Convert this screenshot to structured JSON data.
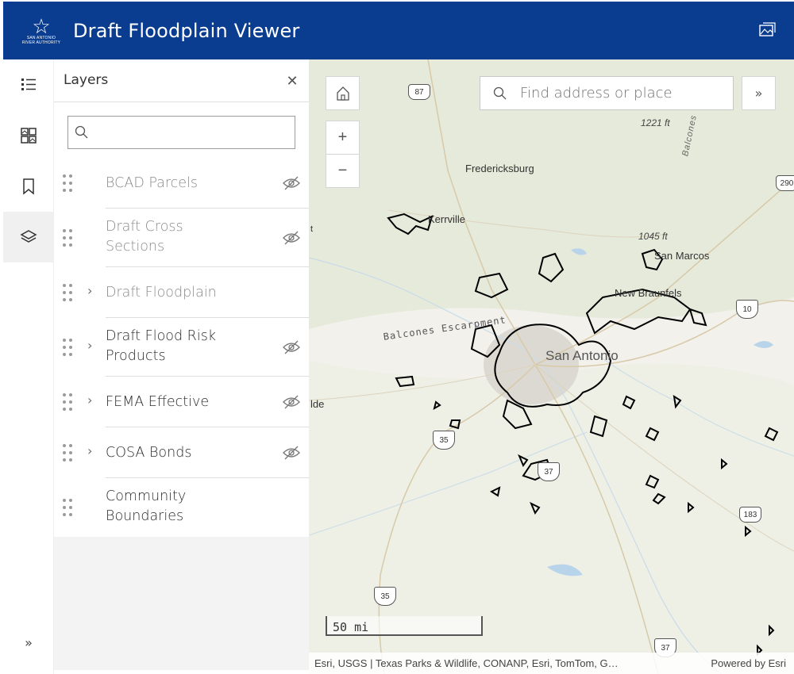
{
  "header": {
    "logo_text_line1": "SAN ANTONIO",
    "logo_text_line2": "RIVER AUTHORITY",
    "title": "Draft Floodplain Viewer"
  },
  "action_bar": {
    "items": [
      {
        "name": "legend",
        "icon": "legend-icon"
      },
      {
        "name": "basemap-gallery",
        "icon": "basemap-gallery-icon"
      },
      {
        "name": "bookmarks",
        "icon": "bookmark-icon"
      },
      {
        "name": "layers",
        "icon": "layers-icon",
        "active": true
      }
    ],
    "expand_label": "»"
  },
  "layers_panel": {
    "title": "Layers",
    "filter_placeholder": "",
    "layers": [
      {
        "name": "BCAD Parcels",
        "visible": false,
        "expandable": false
      },
      {
        "name": "Draft Cross Sections",
        "visible": false,
        "expandable": false
      },
      {
        "name": "Draft Floodplain",
        "visible": false,
        "expandable": true
      },
      {
        "name": "Draft Flood Risk Products",
        "visible": true,
        "expandable": true
      },
      {
        "name": "FEMA Effective",
        "visible": true,
        "expandable": true
      },
      {
        "name": "COSA Bonds",
        "visible": true,
        "expandable": true
      },
      {
        "name": "Community Boundaries",
        "visible": true,
        "expandable": false
      }
    ]
  },
  "map": {
    "search_placeholder": "Find address or place",
    "scale_label": "50 mi",
    "attribution": "Esri, USGS | Texas Parks & Wildlife, CONANP, Esri, TomTom, G…",
    "powered_by": "Powered by Esri",
    "places": [
      "Fredericksburg",
      "Kerrville",
      "San Marcos",
      "New Braunfels",
      "San Antonio",
      "Balcones Escarpment",
      "Balcones",
      "lde",
      "t"
    ],
    "elevations": [
      "1221 ft",
      "1045 ft"
    ],
    "shields": [
      "87",
      "290",
      "10",
      "35",
      "37",
      "183",
      "35",
      "37"
    ]
  },
  "colors": {
    "header": "#0a3d8f",
    "panel_bg": "#f3f3f3",
    "map_bg": "#f2f1ec"
  }
}
